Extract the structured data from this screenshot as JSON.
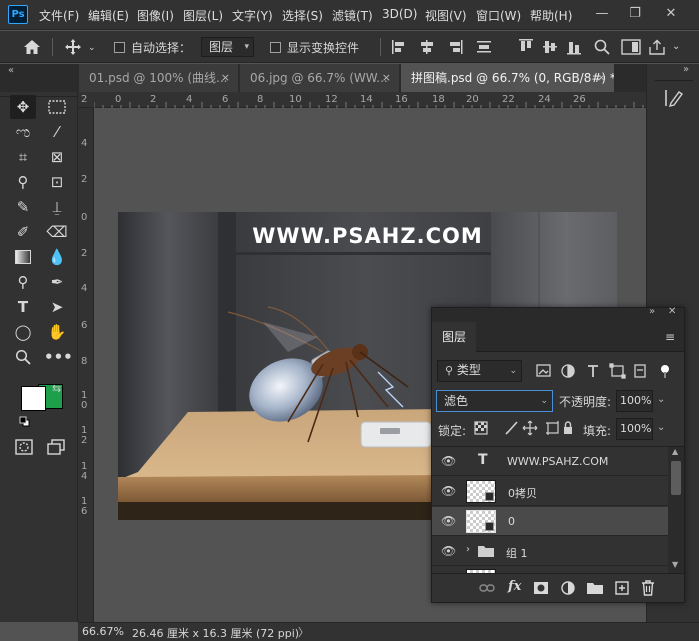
{
  "app": {
    "logo": "Ps"
  },
  "menu": [
    "文件(F)",
    "编辑(E)",
    "图像(I)",
    "图层(L)",
    "文字(Y)",
    "选择(S)",
    "滤镜(T)",
    "3D(D)",
    "视图(V)",
    "窗口(W)",
    "帮助(H)"
  ],
  "window_controls": {
    "minimize": "—",
    "restore": "❐",
    "close": "✕"
  },
  "options": {
    "auto_select_label": "自动选择：",
    "auto_select_value": "图层",
    "show_transform_label": "显示变换控件"
  },
  "tabs": [
    {
      "label": "01.psd @ 100% (曲线...",
      "close": "×",
      "active": false
    },
    {
      "label": "06.jpg @ 66.7% (WW...",
      "close": "×",
      "active": false
    },
    {
      "label": "拼图稿.psd @ 66.7% (0, RGB/8#) *",
      "close": "×",
      "active": true
    }
  ],
  "ruler_h": [
    "2",
    "0",
    "2",
    "4",
    "6",
    "8",
    "10",
    "12",
    "14",
    "16",
    "18",
    "20",
    "22",
    "24",
    "26"
  ],
  "ruler_v": [
    "4",
    "2",
    "0",
    "2",
    "4",
    "6",
    "8",
    "1\n0",
    "1\n2",
    "1\n4",
    "1\n6"
  ],
  "image": {
    "watermark": "WWW.PSAHZ.COM"
  },
  "status": {
    "zoom": "66.67%",
    "doc_info": "26.46 厘米 x 16.3 厘米 (72 ppi)",
    "arrow": "〉"
  },
  "layers_panel": {
    "tab": "图层",
    "filter_kind": "类型",
    "blend_mode": "滤色",
    "opacity_label": "不透明度:",
    "opacity_value": "100%",
    "lock_label": "锁定:",
    "fill_label": "填充:",
    "fill_value": "100%",
    "layers": [
      {
        "name": "WWW.PSAHZ.COM",
        "kind": "text",
        "type_glyph": "T",
        "selected": false
      },
      {
        "name": "0拷贝",
        "kind": "smart",
        "selected": false
      },
      {
        "name": "0",
        "kind": "smart",
        "selected": true
      },
      {
        "name": "组 1",
        "kind": "group",
        "selected": false
      }
    ],
    "footer_icons": [
      "link-icon",
      "fx-icon",
      "mask-icon",
      "adjustment-icon",
      "folder-icon",
      "new-layer-icon",
      "trash-icon"
    ],
    "fx_label": "fx"
  },
  "colors": {
    "foreground": "#ffffff",
    "background": "#1ea04a",
    "accent": "#31a8ff"
  }
}
